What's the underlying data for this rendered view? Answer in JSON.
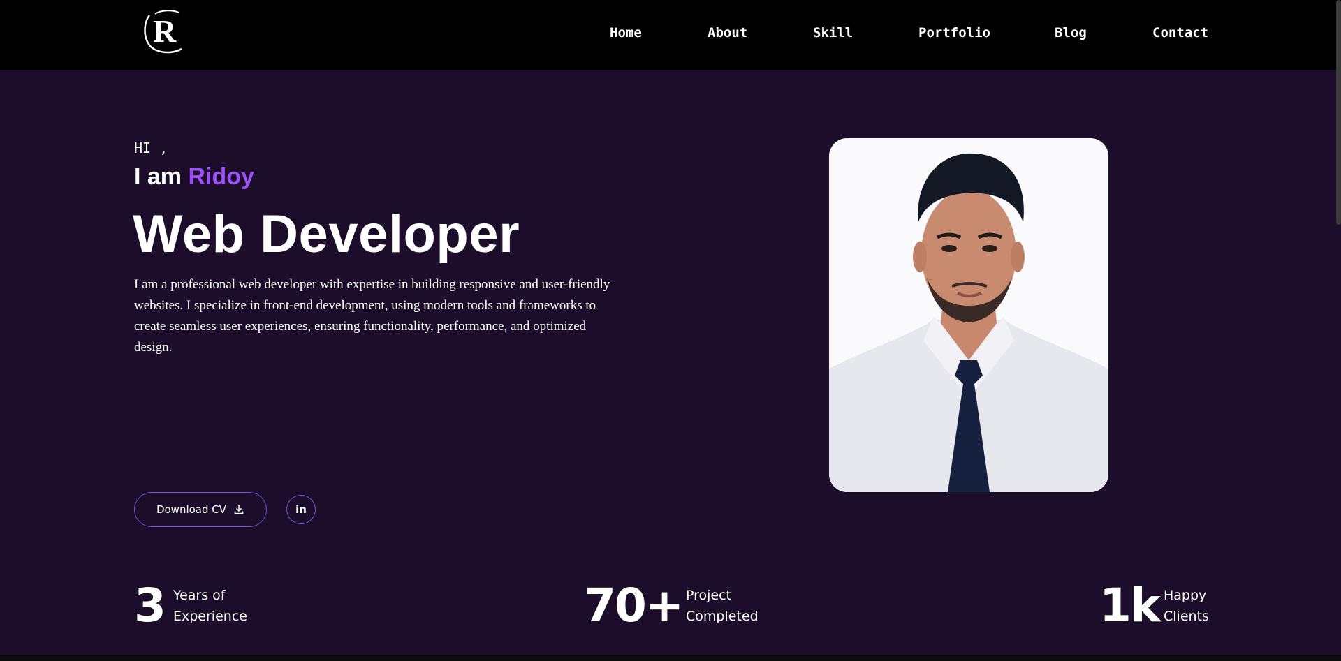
{
  "logo": {
    "letter": "R"
  },
  "nav": {
    "items": [
      {
        "label": "Home"
      },
      {
        "label": "About"
      },
      {
        "label": "Skill"
      },
      {
        "label": "Portfolio"
      },
      {
        "label": "Blog"
      },
      {
        "label": "Contact"
      }
    ]
  },
  "hero": {
    "greeting": "HI ,",
    "intro_prefix": "I am",
    "name": "Ridoy",
    "role": "Web Developer",
    "bio": "I am a professional web developer with expertise in building responsive and user-friendly websites. I specialize in front-end development, using modern tools and frameworks to create seamless user experiences, ensuring functionality, performance, and optimized design.",
    "download_label": "Download CV",
    "download_icon": "download-icon",
    "linkedin_icon": "linkedin-icon",
    "linkedin_glyph": "in"
  },
  "stats": [
    {
      "value": "3",
      "label_line1": "Years of",
      "label_line2": "Experience"
    },
    {
      "value": "70+",
      "label_line1": "Project",
      "label_line2": "Completed"
    },
    {
      "value": "1k",
      "label_line1": "Happy",
      "label_line2": "Clients"
    }
  ],
  "colors": {
    "background": "#1c0e2a",
    "nav_background": "#000000",
    "accent": "#9b51f5",
    "button_border": "#7b4fd8"
  }
}
